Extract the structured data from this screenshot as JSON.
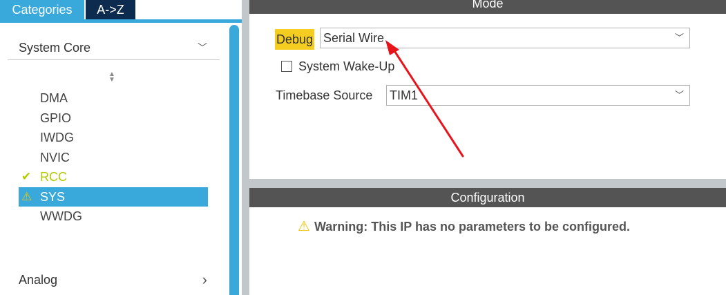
{
  "tabs": {
    "categories": "Categories",
    "az": "A->Z"
  },
  "sidebar": {
    "groups": [
      {
        "label": "System Core",
        "expanded": true
      },
      {
        "label": "Analog",
        "expanded": false
      }
    ],
    "items": [
      {
        "label": "DMA",
        "status": "none"
      },
      {
        "label": "GPIO",
        "status": "none"
      },
      {
        "label": "IWDG",
        "status": "none"
      },
      {
        "label": "NVIC",
        "status": "none"
      },
      {
        "label": "RCC",
        "status": "ok",
        "icon": "check-icon"
      },
      {
        "label": "SYS",
        "status": "warning",
        "icon": "warning-icon",
        "selected": true
      },
      {
        "label": "WWDG",
        "status": "none"
      }
    ]
  },
  "mode": {
    "title": "Mode",
    "debug_label": "Debug",
    "debug_value": "Serial Wire",
    "wakeup_label": "System Wake-Up",
    "wakeup_checked": false,
    "timebase_label": "Timebase Source",
    "timebase_value": "TIM1"
  },
  "configuration": {
    "title": "Configuration",
    "warning_text": "Warning: This IP has no parameters to be configured."
  },
  "glyphs": {
    "check": "✔",
    "warning": "⚠",
    "chevron_down": "﹀",
    "chevron_right": "›",
    "sort": "▲▼"
  },
  "colors": {
    "accent": "#39a9dc",
    "tab_dark": "#0d2b4e",
    "header_gray": "#545454",
    "highlight": "#f5cc20",
    "ok_green": "#b5c800",
    "warning_yellow": "#f3c300",
    "annotation_red": "#e8141b"
  }
}
